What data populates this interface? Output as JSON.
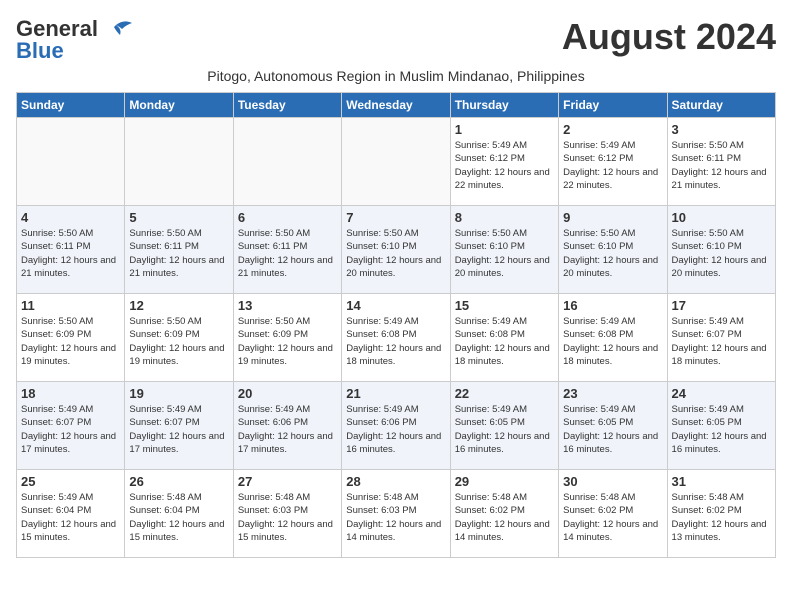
{
  "header": {
    "logo_general": "General",
    "logo_blue": "Blue",
    "month_year": "August 2024",
    "subtitle": "Pitogo, Autonomous Region in Muslim Mindanao, Philippines"
  },
  "days_of_week": [
    "Sunday",
    "Monday",
    "Tuesday",
    "Wednesday",
    "Thursday",
    "Friday",
    "Saturday"
  ],
  "weeks": [
    [
      {
        "day": "",
        "info": ""
      },
      {
        "day": "",
        "info": ""
      },
      {
        "day": "",
        "info": ""
      },
      {
        "day": "",
        "info": ""
      },
      {
        "day": "1",
        "sunrise": "5:49 AM",
        "sunset": "6:12 PM",
        "daylight": "12 hours and 22 minutes."
      },
      {
        "day": "2",
        "sunrise": "5:49 AM",
        "sunset": "6:12 PM",
        "daylight": "12 hours and 22 minutes."
      },
      {
        "day": "3",
        "sunrise": "5:50 AM",
        "sunset": "6:11 PM",
        "daylight": "12 hours and 21 minutes."
      }
    ],
    [
      {
        "day": "4",
        "sunrise": "5:50 AM",
        "sunset": "6:11 PM",
        "daylight": "12 hours and 21 minutes."
      },
      {
        "day": "5",
        "sunrise": "5:50 AM",
        "sunset": "6:11 PM",
        "daylight": "12 hours and 21 minutes."
      },
      {
        "day": "6",
        "sunrise": "5:50 AM",
        "sunset": "6:11 PM",
        "daylight": "12 hours and 21 minutes."
      },
      {
        "day": "7",
        "sunrise": "5:50 AM",
        "sunset": "6:10 PM",
        "daylight": "12 hours and 20 minutes."
      },
      {
        "day": "8",
        "sunrise": "5:50 AM",
        "sunset": "6:10 PM",
        "daylight": "12 hours and 20 minutes."
      },
      {
        "day": "9",
        "sunrise": "5:50 AM",
        "sunset": "6:10 PM",
        "daylight": "12 hours and 20 minutes."
      },
      {
        "day": "10",
        "sunrise": "5:50 AM",
        "sunset": "6:10 PM",
        "daylight": "12 hours and 20 minutes."
      }
    ],
    [
      {
        "day": "11",
        "sunrise": "5:50 AM",
        "sunset": "6:09 PM",
        "daylight": "12 hours and 19 minutes."
      },
      {
        "day": "12",
        "sunrise": "5:50 AM",
        "sunset": "6:09 PM",
        "daylight": "12 hours and 19 minutes."
      },
      {
        "day": "13",
        "sunrise": "5:50 AM",
        "sunset": "6:09 PM",
        "daylight": "12 hours and 19 minutes."
      },
      {
        "day": "14",
        "sunrise": "5:49 AM",
        "sunset": "6:08 PM",
        "daylight": "12 hours and 18 minutes."
      },
      {
        "day": "15",
        "sunrise": "5:49 AM",
        "sunset": "6:08 PM",
        "daylight": "12 hours and 18 minutes."
      },
      {
        "day": "16",
        "sunrise": "5:49 AM",
        "sunset": "6:08 PM",
        "daylight": "12 hours and 18 minutes."
      },
      {
        "day": "17",
        "sunrise": "5:49 AM",
        "sunset": "6:07 PM",
        "daylight": "12 hours and 18 minutes."
      }
    ],
    [
      {
        "day": "18",
        "sunrise": "5:49 AM",
        "sunset": "6:07 PM",
        "daylight": "12 hours and 17 minutes."
      },
      {
        "day": "19",
        "sunrise": "5:49 AM",
        "sunset": "6:07 PM",
        "daylight": "12 hours and 17 minutes."
      },
      {
        "day": "20",
        "sunrise": "5:49 AM",
        "sunset": "6:06 PM",
        "daylight": "12 hours and 17 minutes."
      },
      {
        "day": "21",
        "sunrise": "5:49 AM",
        "sunset": "6:06 PM",
        "daylight": "12 hours and 16 minutes."
      },
      {
        "day": "22",
        "sunrise": "5:49 AM",
        "sunset": "6:05 PM",
        "daylight": "12 hours and 16 minutes."
      },
      {
        "day": "23",
        "sunrise": "5:49 AM",
        "sunset": "6:05 PM",
        "daylight": "12 hours and 16 minutes."
      },
      {
        "day": "24",
        "sunrise": "5:49 AM",
        "sunset": "6:05 PM",
        "daylight": "12 hours and 16 minutes."
      }
    ],
    [
      {
        "day": "25",
        "sunrise": "5:49 AM",
        "sunset": "6:04 PM",
        "daylight": "12 hours and 15 minutes."
      },
      {
        "day": "26",
        "sunrise": "5:48 AM",
        "sunset": "6:04 PM",
        "daylight": "12 hours and 15 minutes."
      },
      {
        "day": "27",
        "sunrise": "5:48 AM",
        "sunset": "6:03 PM",
        "daylight": "12 hours and 15 minutes."
      },
      {
        "day": "28",
        "sunrise": "5:48 AM",
        "sunset": "6:03 PM",
        "daylight": "12 hours and 14 minutes."
      },
      {
        "day": "29",
        "sunrise": "5:48 AM",
        "sunset": "6:02 PM",
        "daylight": "12 hours and 14 minutes."
      },
      {
        "day": "30",
        "sunrise": "5:48 AM",
        "sunset": "6:02 PM",
        "daylight": "12 hours and 14 minutes."
      },
      {
        "day": "31",
        "sunrise": "5:48 AM",
        "sunset": "6:02 PM",
        "daylight": "12 hours and 13 minutes."
      }
    ]
  ]
}
